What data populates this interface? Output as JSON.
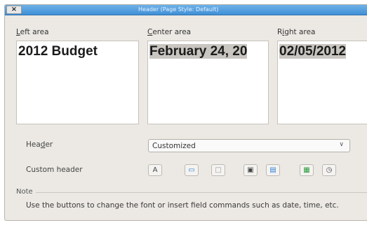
{
  "window": {
    "title": "Header (Page Style: Default)",
    "close_glyph": "×"
  },
  "areas": {
    "left": {
      "label_mnemonic": "L",
      "label_rest": "eft area",
      "text": "2012 Budget"
    },
    "center": {
      "label_mnemonic": "C",
      "label_rest": "enter area",
      "text": "February 24, 20"
    },
    "right": {
      "label_pre": "R",
      "label_mnemonic": "i",
      "label_rest": "ght area",
      "text": "02/05/2012"
    }
  },
  "header": {
    "label_pre": "Hea",
    "label_mnemonic": "d",
    "label_rest": "er",
    "selected_option": "Customized",
    "arrow_glyph": "∨"
  },
  "custom_header": {
    "label": "Custom header",
    "buttons": [
      {
        "name": "text-attributes-icon",
        "glyph": "A"
      },
      {
        "name": "title-icon",
        "glyph": "▭"
      },
      {
        "name": "file-name-icon",
        "glyph": "□"
      },
      {
        "name": "sheet-name-icon",
        "glyph": "▣"
      },
      {
        "name": "page-icon",
        "glyph": "▤"
      },
      {
        "name": "date-icon",
        "glyph": "▦"
      },
      {
        "name": "time-icon",
        "glyph": "◷"
      }
    ]
  },
  "note": {
    "label": "Note",
    "text": "Use the buttons to change the font or insert field commands such as date, time, etc."
  },
  "colors": {
    "titlebar": "#4a98dd",
    "dialog_bg": "#ece9e4",
    "selection": "#c9c6c1"
  }
}
